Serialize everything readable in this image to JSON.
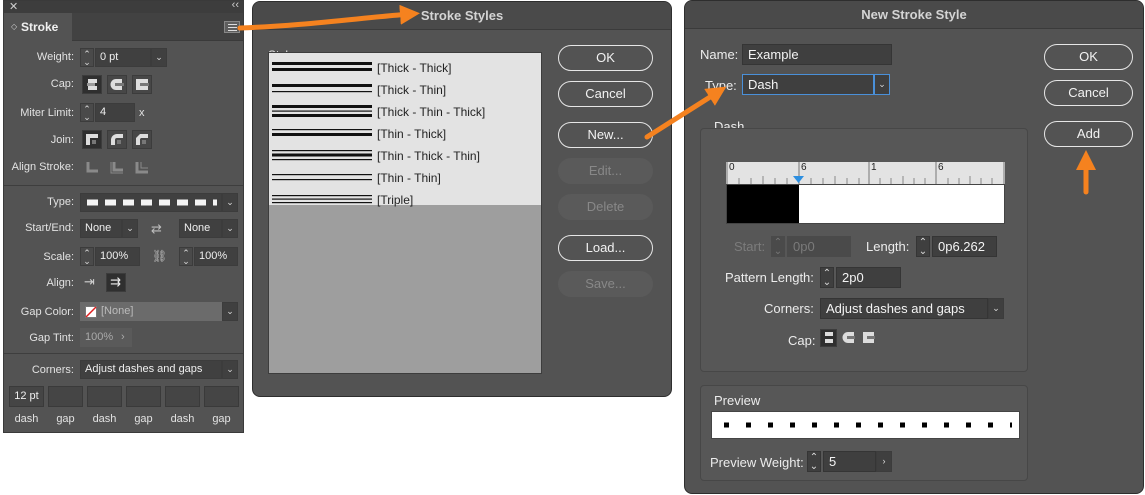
{
  "stroke_panel": {
    "tab_label": "Stroke",
    "weight_label": "Weight:",
    "weight_value": "0 pt",
    "cap_label": "Cap:",
    "miter_label": "Miter Limit:",
    "miter_value": "4",
    "miter_suffix": "x",
    "join_label": "Join:",
    "align_stroke_label": "Align Stroke:",
    "type_label": "Type:",
    "start_end_label": "Start/End:",
    "start_value": "None",
    "end_value": "None",
    "scale_label": "Scale:",
    "scale_start": "100%",
    "scale_end": "100%",
    "align_label": "Align:",
    "gap_color_label": "Gap Color:",
    "gap_color_value": "[None]",
    "gap_tint_label": "Gap Tint:",
    "gap_tint_value": "100%",
    "corners_label": "Corners:",
    "corners_value": "Adjust dashes and gaps",
    "dash_gap_values": [
      "12 pt",
      "",
      "",
      "",
      "",
      ""
    ],
    "dash_gap_labels": [
      "dash",
      "gap",
      "dash",
      "gap",
      "dash",
      "gap"
    ]
  },
  "stroke_styles_dialog": {
    "title": "Stroke Styles",
    "styles_label": "Styles:",
    "styles": [
      "[Thick - Thick]",
      "[Thick - Thin]",
      "[Thick - Thin - Thick]",
      "[Thin - Thick]",
      "[Thin - Thick - Thin]",
      "[Thin - Thin]",
      "[Triple]"
    ],
    "buttons": {
      "ok": "OK",
      "cancel": "Cancel",
      "new": "New...",
      "edit": "Edit...",
      "delete": "Delete",
      "load": "Load...",
      "save": "Save..."
    }
  },
  "new_stroke_style_dialog": {
    "title": "New Stroke Style",
    "name_label": "Name:",
    "name_value": "Example",
    "type_label": "Type:",
    "type_value": "Dash",
    "dash_group_label": "Dash",
    "ruler_labels": [
      "0",
      "6",
      "1",
      "6"
    ],
    "start_label": "Start:",
    "start_value": "0p0",
    "length_label": "Length:",
    "length_value": "0p6.262",
    "pattern_length_label": "Pattern Length:",
    "pattern_length_value": "2p0",
    "corners_label": "Corners:",
    "corners_value": "Adjust dashes and gaps",
    "cap_label": "Cap:",
    "preview_label": "Preview",
    "preview_weight_label": "Preview Weight:",
    "preview_weight_value": "5",
    "buttons": {
      "ok": "OK",
      "cancel": "Cancel",
      "add": "Add"
    }
  },
  "annotation_color": "#f5821f"
}
